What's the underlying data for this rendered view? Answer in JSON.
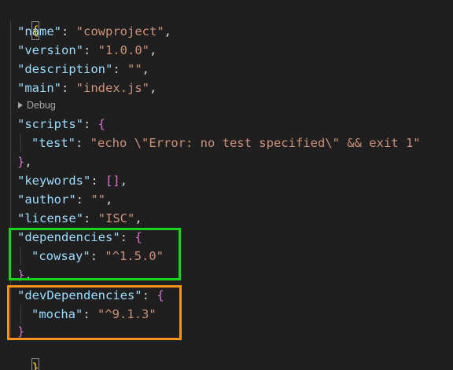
{
  "editor": {
    "open_brace": "{",
    "close_brace": "}",
    "codelens": {
      "label": "Debug"
    },
    "lines": {
      "name": {
        "key": "\"name\"",
        "value": "\"cowproject\""
      },
      "version": {
        "key": "\"version\"",
        "value": "\"1.0.0\""
      },
      "description": {
        "key": "\"description\"",
        "value": "\"\""
      },
      "main": {
        "key": "\"main\"",
        "value": "\"index.js\""
      },
      "scripts": {
        "key": "\"scripts\""
      },
      "test": {
        "key": "\"test\"",
        "value": "\"echo \\\"Error: no test specified\\\" && exit 1\""
      },
      "keywords": {
        "key": "\"keywords\"",
        "value": "[]"
      },
      "author": {
        "key": "\"author\"",
        "value": "\"\""
      },
      "license": {
        "key": "\"license\"",
        "value": "\"ISC\""
      },
      "dependencies": {
        "key": "\"dependencies\""
      },
      "cowsay": {
        "key": "\"cowsay\"",
        "value": "\"^1.5.0\""
      },
      "devDependencies": {
        "key": "\"devDependencies\""
      },
      "mocha": {
        "key": "\"mocha\"",
        "value": "\"^9.1.3\""
      }
    }
  },
  "highlight_colors": {
    "dependencies_box": "#19d319",
    "devDependencies_box": "#f7941d"
  }
}
